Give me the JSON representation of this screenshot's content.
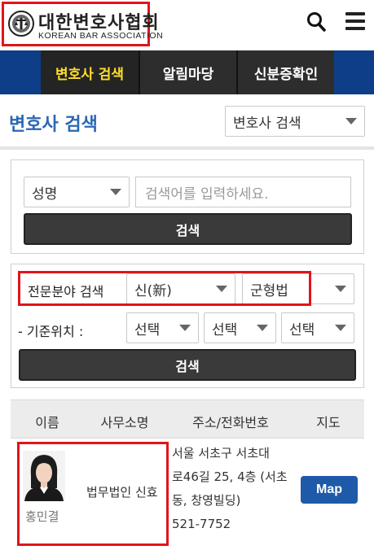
{
  "header": {
    "logo_korean": "대한변호사협회",
    "logo_english": "KOREAN BAR ASSOCIATION",
    "search_icon": "search-icon",
    "menu_icon": "hamburger-menu-icon"
  },
  "nav": {
    "tabs": [
      {
        "label": "변호사 검색",
        "active": true
      },
      {
        "label": "알림마당",
        "active": false
      },
      {
        "label": "신분증확인",
        "active": false
      }
    ]
  },
  "page": {
    "title": "변호사 검색",
    "type_select": "변호사 검색"
  },
  "name_search": {
    "field_select": "성명",
    "input_placeholder": "검색어를 입력하세요.",
    "button_label": "검색"
  },
  "specialty_search": {
    "specialty_label": "전문분야 검색",
    "specialty_select_1": "신(新)",
    "specialty_select_2": "군형법",
    "location_label": "- 기준위치 :",
    "location_select_1": "선택",
    "location_select_2": "선택",
    "location_select_3": "선택",
    "button_label": "검색"
  },
  "results": {
    "columns": [
      "이름",
      "사무소명",
      "주소/전화번호",
      "지도"
    ],
    "rows": [
      {
        "name": "홍민결",
        "office": "법무법인 신효",
        "address_lines": [
          "서울 서초구 서초대",
          "로46길 25, 4층 (서초",
          "동, 창영빌딩)",
          "521-7752"
        ],
        "map_label": "Map"
      }
    ]
  },
  "colors": {
    "nav_blue": "#0e3e87",
    "active_tab_text": "#ffde2a",
    "title_blue": "#2a67b3",
    "map_button": "#1f5aa8",
    "highlight_red": "#e0151a"
  }
}
